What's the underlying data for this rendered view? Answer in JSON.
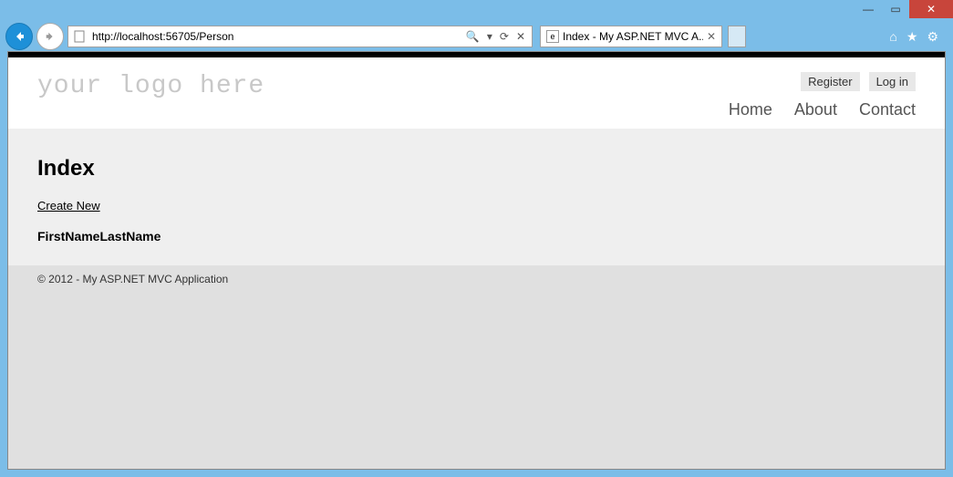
{
  "window": {
    "minimize": "—",
    "maximize": "▭",
    "close": "✕"
  },
  "browser": {
    "url": "http://localhost:56705/Person",
    "tab_title": "Index - My ASP.NET MVC A...",
    "search_glyph": "🔍",
    "dropdown_glyph": "▾",
    "refresh_glyph": "⟳",
    "stop_glyph": "✕",
    "home_glyph": "⌂",
    "star_glyph": "★",
    "gear_glyph": "⚙"
  },
  "header": {
    "logo": "your logo here",
    "auth": {
      "register": "Register",
      "login": "Log in"
    },
    "nav": {
      "home": "Home",
      "about": "About",
      "contact": "Contact"
    }
  },
  "main": {
    "title": "Index",
    "create_link": "Create New",
    "columns": {
      "first": "FirstName",
      "last": "LastName"
    }
  },
  "footer": {
    "text": "© 2012 - My ASP.NET MVC Application"
  }
}
